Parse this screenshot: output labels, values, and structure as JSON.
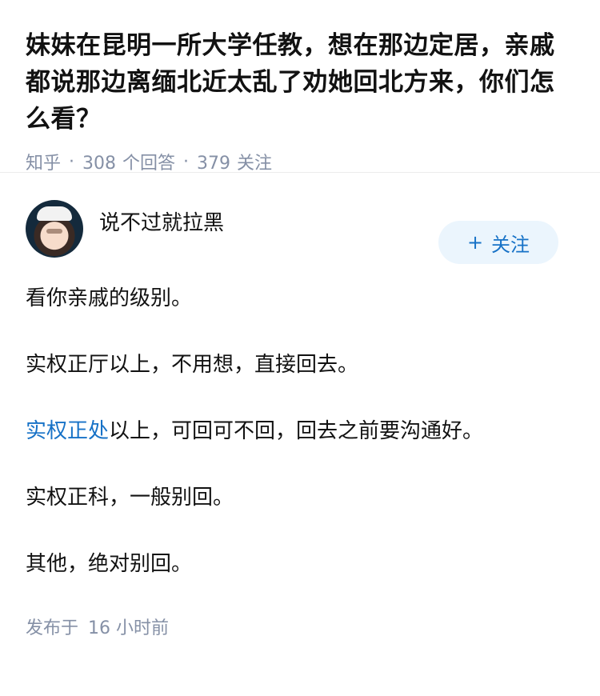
{
  "question": {
    "title": "妹妹在昆明一所大学任教，想在那边定居，亲戚都说那边离缅北近太乱了劝她回北方来，你们怎么看？",
    "source": "知乎",
    "answer_count": "308",
    "answer_label": "个回答",
    "follower_count": "379",
    "follower_label": "关注"
  },
  "answer": {
    "author_name": "说不过就拉黑",
    "follow_label": "关注",
    "follow_icon": "plus-icon",
    "paragraphs": {
      "p1": "看你亲戚的级别。",
      "p2": "实权正厅以上，不用想，直接回去。",
      "p3_link": "实权正处",
      "p3_rest": "以上，可回可不回，回去之前要沟通好。",
      "p4": "实权正科，一般别回。",
      "p5": "其他，绝对别回。"
    },
    "published_prefix": "发布于",
    "published_time": "16 小时前"
  },
  "colors": {
    "accent": "#1772c7",
    "button_bg": "#ebf5fd",
    "meta": "#8590a6",
    "text": "#121212"
  }
}
